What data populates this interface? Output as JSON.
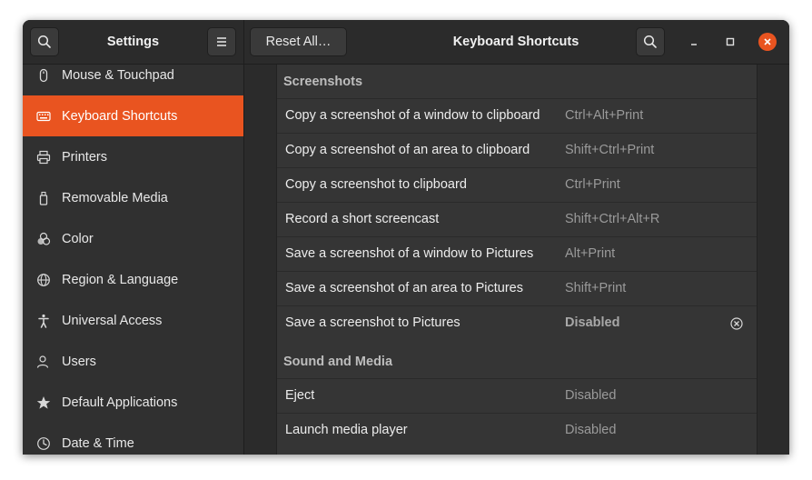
{
  "headerbar": {
    "app_title": "Settings",
    "reset_label": "Reset All…",
    "page_title": "Keyboard Shortcuts"
  },
  "sidebar": {
    "items": [
      {
        "label": "Mouse & Touchpad",
        "icon": "mouse-icon"
      },
      {
        "label": "Keyboard Shortcuts",
        "icon": "keyboard-icon",
        "active": true
      },
      {
        "label": "Printers",
        "icon": "printer-icon"
      },
      {
        "label": "Removable Media",
        "icon": "usb-icon"
      },
      {
        "label": "Color",
        "icon": "color-icon"
      },
      {
        "label": "Region & Language",
        "icon": "globe-icon"
      },
      {
        "label": "Universal Access",
        "icon": "accessibility-icon"
      },
      {
        "label": "Users",
        "icon": "users-icon"
      },
      {
        "label": "Default Applications",
        "icon": "star-icon"
      },
      {
        "label": "Date & Time",
        "icon": "clock-icon"
      }
    ]
  },
  "shortcuts": {
    "screenshots": {
      "title": "Screenshots",
      "rows": [
        {
          "label": "Copy a screenshot of a window to clipboard",
          "accel": "Ctrl+Alt+Print"
        },
        {
          "label": "Copy a screenshot of an area to clipboard",
          "accel": "Shift+Ctrl+Print"
        },
        {
          "label": "Copy a screenshot to clipboard",
          "accel": "Ctrl+Print"
        },
        {
          "label": "Record a short screencast",
          "accel": "Shift+Ctrl+Alt+R"
        },
        {
          "label": "Save a screenshot of a window to Pictures",
          "accel": "Alt+Print"
        },
        {
          "label": "Save a screenshot of an area to Pictures",
          "accel": "Shift+Print"
        },
        {
          "label": "Save a screenshot to Pictures",
          "accel": "Disabled"
        }
      ]
    },
    "sound_media": {
      "title": "Sound and Media",
      "rows": [
        {
          "label": "Eject",
          "accel": "Disabled"
        },
        {
          "label": "Launch media player",
          "accel": "Disabled"
        }
      ]
    }
  },
  "colors": {
    "accent": "#e95420",
    "window_bg": "#2d2d2d",
    "panel_bg": "#353535"
  }
}
